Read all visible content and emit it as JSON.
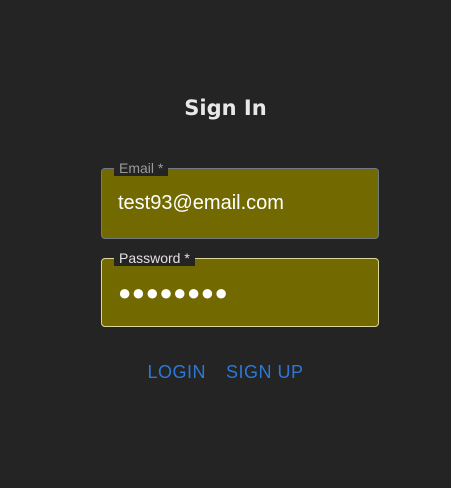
{
  "form": {
    "title": "Sign In",
    "email": {
      "label": "Email *",
      "value": "test93@email.com"
    },
    "password": {
      "label": "Password *",
      "value": "●●●●●●●●"
    },
    "actions": {
      "login_label": "LOGIN",
      "signup_label": "SIGN UP"
    }
  },
  "colors": {
    "background": "#242424",
    "field_fill": "#726a00",
    "link": "#2b78d6"
  }
}
